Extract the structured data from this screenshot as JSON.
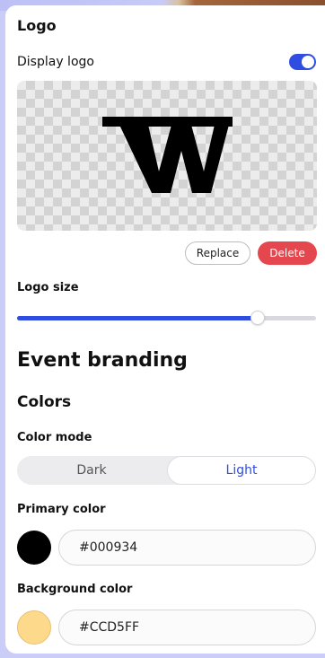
{
  "logo_section": {
    "title": "Logo",
    "display_logo_label": "Display logo",
    "display_logo_enabled": true,
    "logo_letter": "W",
    "replace_label": "Replace",
    "delete_label": "Delete"
  },
  "logo_size": {
    "label": "Logo size",
    "value_fraction": 0.805
  },
  "branding": {
    "title": "Event branding",
    "colors_title": "Colors",
    "color_mode_label": "Color mode",
    "modes": [
      "Dark",
      "Light"
    ],
    "selected_mode": "Light",
    "primary_label": "Primary color",
    "primary_value": "#000934",
    "primary_swatch": "#000000",
    "background_label": "Background color",
    "background_value": "#CCD5FF",
    "background_swatch": "#fdd98c"
  },
  "colors": {
    "accent": "#2f4de0",
    "danger": "#e5474e"
  }
}
